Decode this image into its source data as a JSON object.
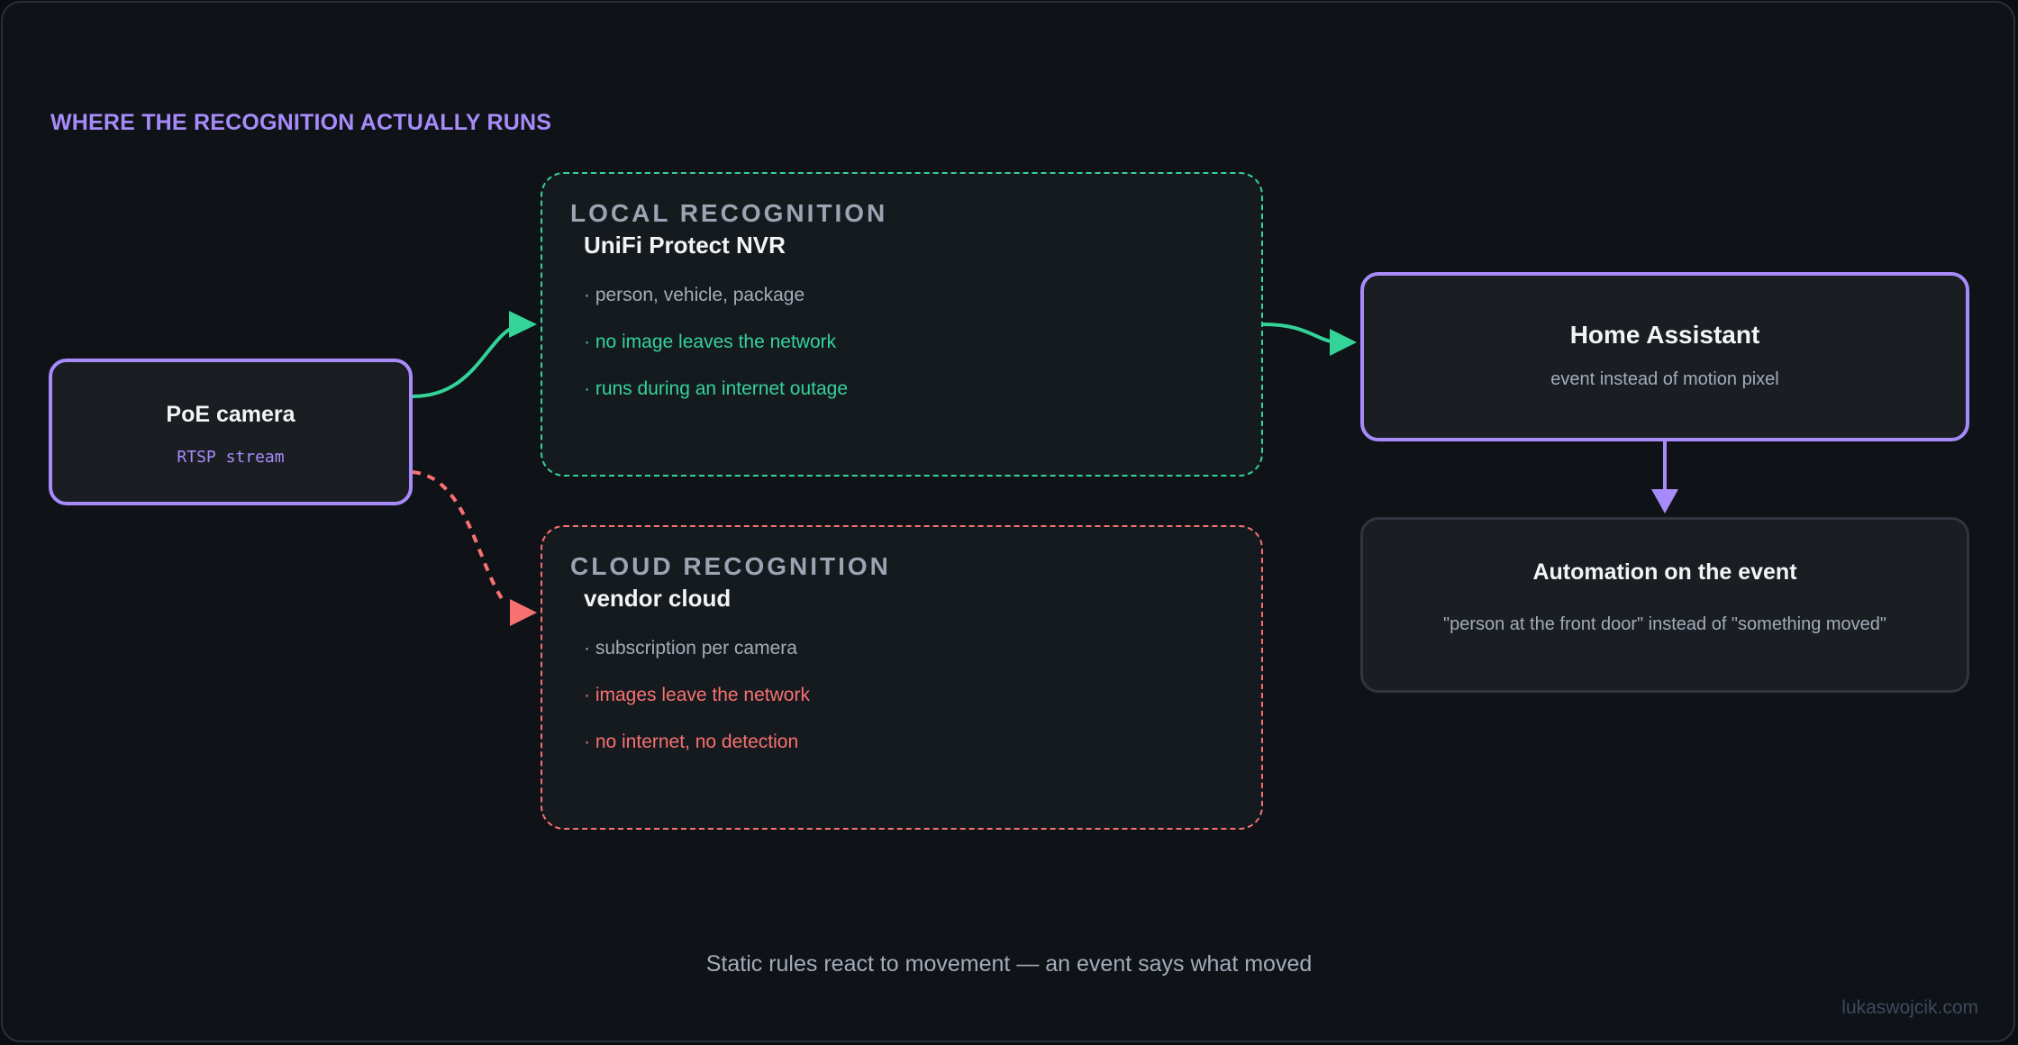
{
  "title": "WHERE THE RECOGNITION ACTUALLY RUNS",
  "camera": {
    "title": "PoE camera",
    "subtitle": "RTSP stream"
  },
  "local": {
    "label": "LOCAL RECOGNITION",
    "title": "UniFi Protect NVR",
    "bullets": [
      "· person, vehicle, package",
      "· no image leaves the network",
      "· runs during an internet outage"
    ]
  },
  "cloud": {
    "label": "CLOUD RECOGNITION",
    "title": "vendor cloud",
    "bullets": [
      "· subscription per camera",
      "· images leave the network",
      "· no internet, no detection"
    ]
  },
  "home_assistant": {
    "title": "Home Assistant",
    "subtitle": "event instead of motion pixel"
  },
  "automation": {
    "title": "Automation on the event",
    "subtitle": "\"person at the front door\" instead of \"something moved\""
  },
  "caption": "Static rules react to movement — an event says what moved",
  "watermark": "lukaswojcik.com",
  "colors": {
    "background": "#0f1216",
    "accent_purple": "#a78bfa",
    "local_green": "#34d399",
    "cloud_red": "#f87171",
    "muted_text": "#a3acb9"
  }
}
